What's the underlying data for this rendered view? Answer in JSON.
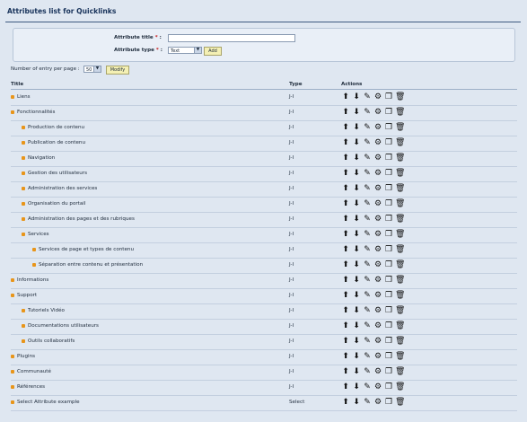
{
  "page_title": "Attributes list for Quicklinks",
  "form": {
    "title_label": "Attribute title",
    "type_label": "Attribute type",
    "required_mark": "*",
    "colon": ":",
    "title_value": "",
    "type_selected": "Text",
    "add_button": "Add"
  },
  "pagination": {
    "label": "Number of entry per page :",
    "selected": "50",
    "modify_button": "Modify"
  },
  "table": {
    "headers": {
      "title": "Title",
      "type": "Type",
      "actions": "Actions"
    },
    "rows": [
      {
        "title": "Liens",
        "type": "J-I",
        "level": 0
      },
      {
        "title": "Fonctionnalités",
        "type": "J-I",
        "level": 0
      },
      {
        "title": "Production de contenu",
        "type": "J-I",
        "level": 1
      },
      {
        "title": "Publication de contenu",
        "type": "J-I",
        "level": 1
      },
      {
        "title": "Navigation",
        "type": "J-I",
        "level": 1
      },
      {
        "title": "Gestion des utilisateurs",
        "type": "J-I",
        "level": 1
      },
      {
        "title": "Administration des services",
        "type": "J-I",
        "level": 1
      },
      {
        "title": "Organisation du portail",
        "type": "J-I",
        "level": 1
      },
      {
        "title": "Administration des pages et des rubriques",
        "type": "J-I",
        "level": 1
      },
      {
        "title": "Services",
        "type": "J-I",
        "level": 1
      },
      {
        "title": "Services de page et types de contenu",
        "type": "J-I",
        "level": 2
      },
      {
        "title": "Séparation entre contenu et présentation",
        "type": "J-I",
        "level": 2
      },
      {
        "title": "Informations",
        "type": "J-I",
        "level": 0
      },
      {
        "title": "Support",
        "type": "J-I",
        "level": 0
      },
      {
        "title": "Tutoriels Vidéo",
        "type": "J-I",
        "level": 1
      },
      {
        "title": "Documentations utilisateurs",
        "type": "J-I",
        "level": 1
      },
      {
        "title": "Outils collaboratifs",
        "type": "J-I",
        "level": 1
      },
      {
        "title": "Plugins",
        "type": "J-I",
        "level": 0
      },
      {
        "title": "Communauté",
        "type": "J-I",
        "level": 0
      },
      {
        "title": "Références",
        "type": "J-I",
        "level": 0
      },
      {
        "title": "Select Attribute example",
        "type": "Select",
        "level": 0
      }
    ],
    "action_icons": [
      "move-up-icon",
      "move-down-icon",
      "edit-icon",
      "properties-icon",
      "copy-icon",
      "delete-icon"
    ]
  },
  "colors": {
    "background": "#dfe7f1",
    "bullet": "#e8951a",
    "title_rule": "#3d5a80",
    "button": "#f4f0b4"
  }
}
